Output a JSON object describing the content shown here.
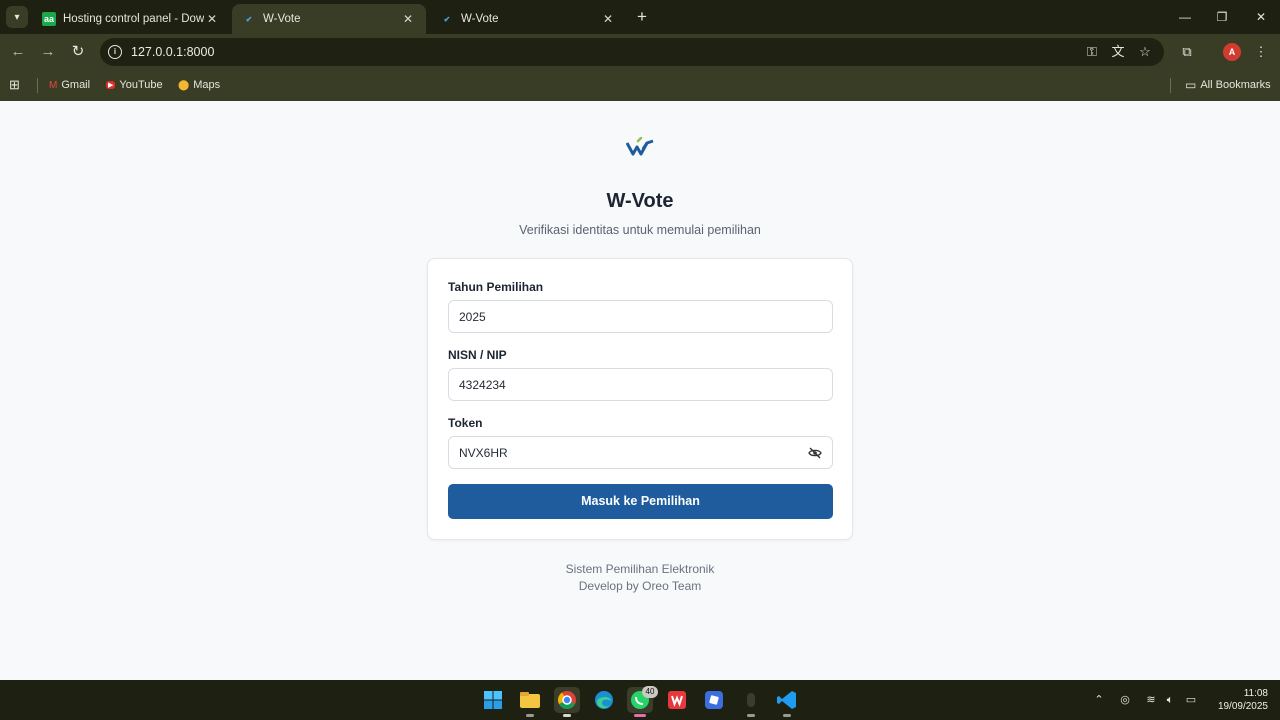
{
  "browser": {
    "tabs": [
      {
        "title": "Hosting control panel - Downlo",
        "favicon": "aa"
      },
      {
        "title": "W-Vote",
        "favicon": "w-vote-icon"
      },
      {
        "title": "W-Vote",
        "favicon": "w-vote-icon"
      }
    ],
    "url": "127.0.0.1:8000",
    "profile_initial": "A",
    "bookmarks": [
      {
        "label": "Gmail",
        "icon": "gmail-icon"
      },
      {
        "label": "YouTube",
        "icon": "youtube-icon"
      },
      {
        "label": "Maps",
        "icon": "maps-icon"
      }
    ],
    "all_bookmarks": "All Bookmarks"
  },
  "page": {
    "title": "W-Vote",
    "subtitle": "Verifikasi identitas untuk memulai pemilihan",
    "form": {
      "year_label": "Tahun Pemilihan",
      "year_value": "2025",
      "id_label": "NISN / NIP",
      "id_value": "4324234",
      "token_label": "Token",
      "token_value": "NVX6HR",
      "submit_label": "Masuk ke Pemilihan"
    },
    "footer_line1": "Sistem Pemilihan Elektronik",
    "footer_line2": "Develop by Oreo Team"
  },
  "taskbar": {
    "whatsapp_badge": "40",
    "time": "11:08",
    "date": "19/09/2025"
  },
  "colors": {
    "brand_primary": "#1f5c9e",
    "chrome_dark": "#1e2012",
    "chrome_toolbar": "#3a3d26",
    "page_bg": "#f8f9fb"
  }
}
